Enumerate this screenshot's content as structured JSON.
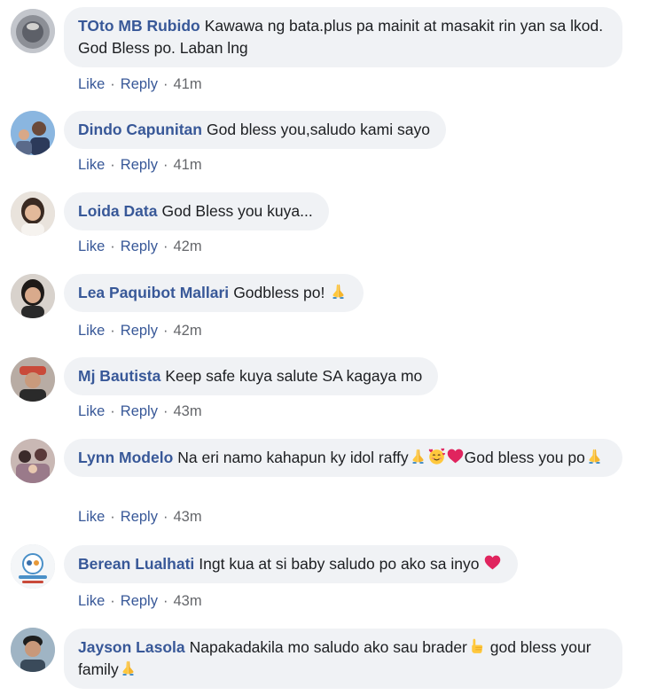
{
  "actions": {
    "like": "Like",
    "reply": "Reply",
    "separator": "·"
  },
  "comments": [
    {
      "author": "TOto MB Rubido",
      "text": "Kawawa ng bata.plus pa mainit at masakit rin yan sa lkod. God Bless po. Laban lng",
      "time": "41m"
    },
    {
      "author": "Dindo Capunitan",
      "text": "God bless you,saludo kami sayo",
      "time": "41m"
    },
    {
      "author": "Loida Data",
      "text": "God Bless you kuya...",
      "time": "42m"
    },
    {
      "author": "Lea Paquibot Mallari",
      "text": "Godbless po! ",
      "emoji_after": "folded-hands-icon",
      "time": "42m"
    },
    {
      "author": "Mj Bautista",
      "text": "Keep safe kuya salute SA kagaya mo",
      "time": "43m"
    },
    {
      "author": "Lynn Modelo",
      "text_a": "Na eri namo kahapun ky idol raffy",
      "text_b": "God bless you po",
      "time": "43m"
    },
    {
      "author": "Berean Lualhati",
      "text": "Ingt kua at si baby saludo po ako sa inyo ",
      "time": "43m"
    },
    {
      "author": "Jayson Lasola",
      "text_a": "Napakadakila mo saludo ako sau brader",
      "text_b": " god bless your family"
    }
  ],
  "colors": {
    "author": "#385898",
    "bubble": "#f0f2f5",
    "meta": "#65676b",
    "heart": "#e0245e",
    "emoji_yellow": "#ffc83d"
  }
}
